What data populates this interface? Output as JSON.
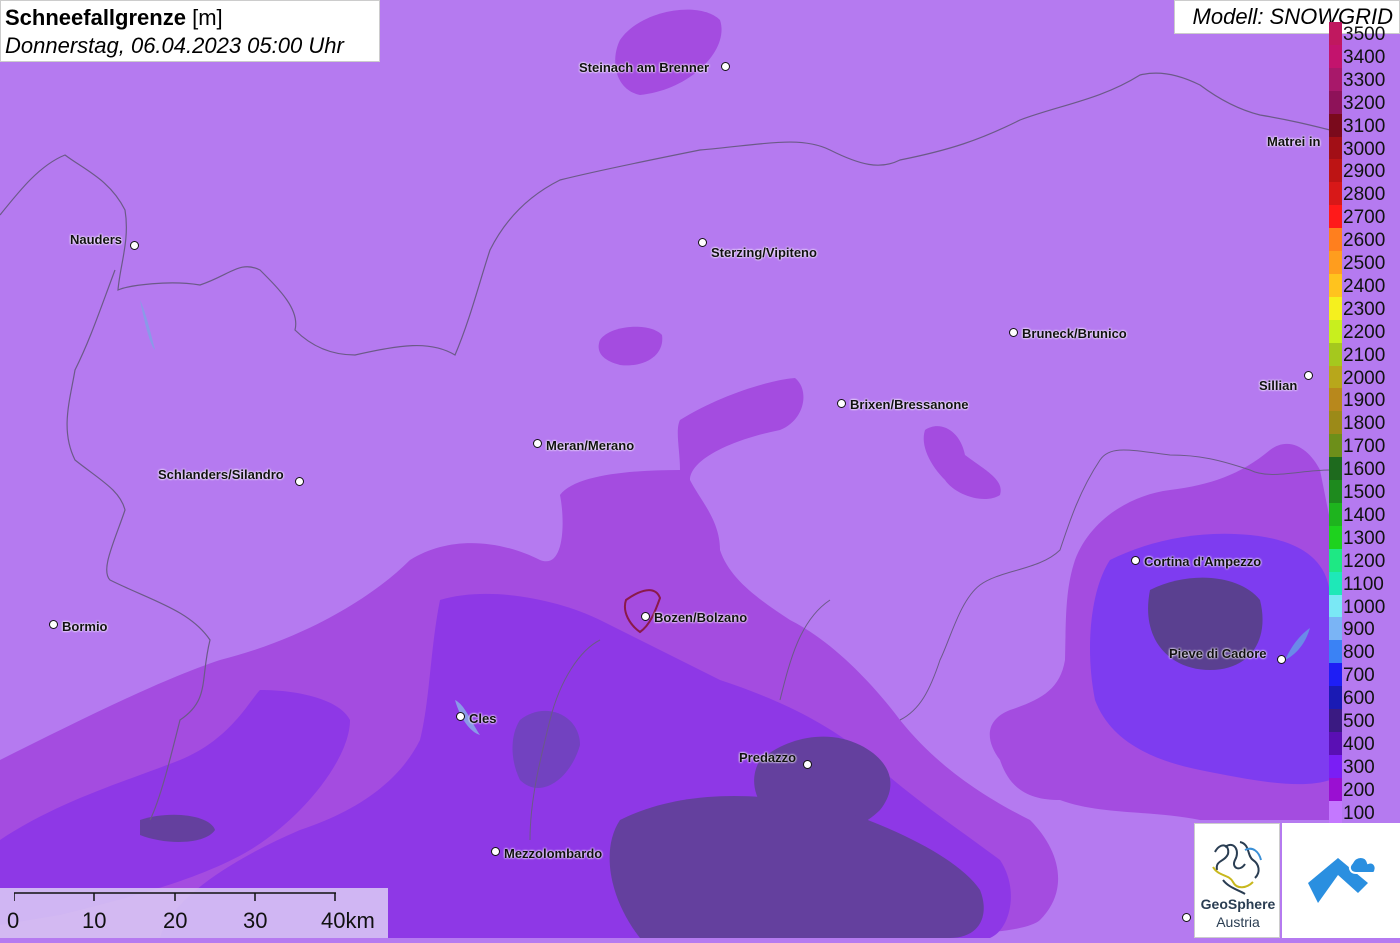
{
  "header": {
    "title": "Schneefallgrenze",
    "unit": "[m]",
    "datetime": "Donnerstag, 06.04.2023 05:00 Uhr",
    "model": "Modell: SNOWGRID"
  },
  "legend": {
    "items": [
      {
        "label": "3500",
        "color": "#c0185f"
      },
      {
        "label": "3400",
        "color": "#c3136d"
      },
      {
        "label": "3300",
        "color": "#a8186a"
      },
      {
        "label": "3200",
        "color": "#8e1259"
      },
      {
        "label": "3100",
        "color": "#7a0a1c"
      },
      {
        "label": "3000",
        "color": "#a20f16"
      },
      {
        "label": "2900",
        "color": "#bd1414"
      },
      {
        "label": "2800",
        "color": "#d81818"
      },
      {
        "label": "2700",
        "color": "#ff1a1a"
      },
      {
        "label": "2600",
        "color": "#ff7f1e"
      },
      {
        "label": "2500",
        "color": "#ff9d1e"
      },
      {
        "label": "2400",
        "color": "#ffc31e"
      },
      {
        "label": "2300",
        "color": "#f5f01e"
      },
      {
        "label": "2200",
        "color": "#c8ef1e"
      },
      {
        "label": "2100",
        "color": "#a5c81e"
      },
      {
        "label": "2000",
        "color": "#b8a71b"
      },
      {
        "label": "1900",
        "color": "#b8881c"
      },
      {
        "label": "1800",
        "color": "#9c8a18"
      },
      {
        "label": "1700",
        "color": "#6d8f1a"
      },
      {
        "label": "1600",
        "color": "#1e6a1e"
      },
      {
        "label": "1500",
        "color": "#1e8a1e"
      },
      {
        "label": "1400",
        "color": "#1eb41e"
      },
      {
        "label": "1300",
        "color": "#1ed21e"
      },
      {
        "label": "1200",
        "color": "#1ee884"
      },
      {
        "label": "1100",
        "color": "#1ee8b8"
      },
      {
        "label": "1000",
        "color": "#7ae8f5"
      },
      {
        "label": "900",
        "color": "#7ab4f5"
      },
      {
        "label": "800",
        "color": "#3a82f5"
      },
      {
        "label": "700",
        "color": "#1e1ef5"
      },
      {
        "label": "600",
        "color": "#1a1ab4"
      },
      {
        "label": "500",
        "color": "#3a1a82"
      },
      {
        "label": "400",
        "color": "#5a0fb4"
      },
      {
        "label": "300",
        "color": "#7a1ef5"
      },
      {
        "label": "200",
        "color": "#9a0fd2"
      },
      {
        "label": "100",
        "color": "#c478ff"
      }
    ]
  },
  "cities": [
    {
      "name": "Steinach am Brenner",
      "key": "steinach"
    },
    {
      "name": "Nauders",
      "key": "nauders"
    },
    {
      "name": "Sterzing/Vipiteno",
      "key": "sterzing"
    },
    {
      "name": "Matrei in",
      "key": "matrei"
    },
    {
      "name": "Bruneck/Brunico",
      "key": "bruneck"
    },
    {
      "name": "Sillian",
      "key": "sillian"
    },
    {
      "name": "Brixen/Bressanone",
      "key": "brixen"
    },
    {
      "name": "Meran/Merano",
      "key": "meran"
    },
    {
      "name": "Schlanders/Silandro",
      "key": "schlanders"
    },
    {
      "name": "Cortina d'Ampezzo",
      "key": "cortina"
    },
    {
      "name": "Bormio",
      "key": "bormio"
    },
    {
      "name": "Bozen/Bolzano",
      "key": "bozen"
    },
    {
      "name": "Pieve di Cadore",
      "key": "pieve"
    },
    {
      "name": "Cles",
      "key": "cles"
    },
    {
      "name": "Predazzo",
      "key": "predazzo"
    },
    {
      "name": "Mezzolombardo",
      "key": "mezzolombardo"
    }
  ],
  "scale": {
    "labels": [
      "0",
      "10",
      "20",
      "30",
      "40km"
    ]
  },
  "logos": {
    "geosphere_line1": "GeoSphere",
    "geosphere_line2": "Austria"
  },
  "map_colors": {
    "base": "#b57af0",
    "zone_200": "#a44ce0",
    "zone_300": "#8e38e6",
    "zone_400": "#7e3cf0",
    "zone_500": "#64409e",
    "border": "#6b5a88"
  }
}
